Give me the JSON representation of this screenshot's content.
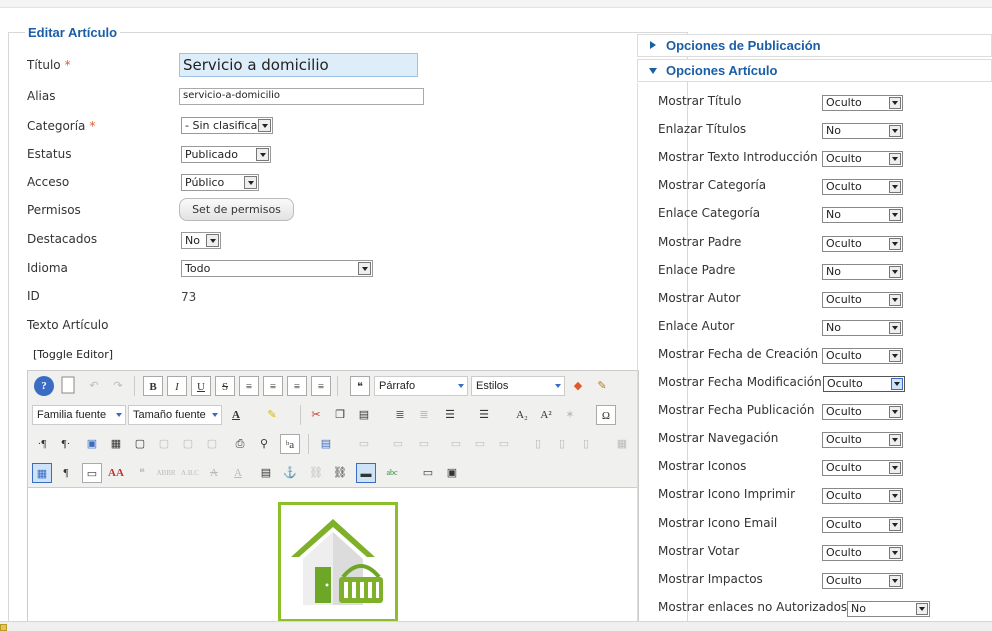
{
  "form": {
    "legend": "Editar Artículo",
    "required_mark": "*",
    "fields": {
      "title_label": "Título",
      "title_value": "Servicio a domicilio",
      "alias_label": "Alias",
      "alias_value": "servicio-a-domicilio",
      "category_label": "Categoría",
      "category_value": "- Sin clasificar",
      "status_label": "Estatus",
      "status_value": "Publicado",
      "access_label": "Acceso",
      "access_value": "Público",
      "permissions_label": "Permisos",
      "permissions_button": "Set de permisos",
      "featured_label": "Destacados",
      "featured_value": "No",
      "language_label": "Idioma",
      "language_value": "Todo",
      "id_label": "ID",
      "id_value": "73",
      "text_label": "Texto Artículo",
      "toggle_editor": "[Toggle Editor]"
    }
  },
  "editor": {
    "format_select": "Párrafo",
    "styles_select": "Estilos",
    "font_family_select": "Familia fuente",
    "font_size_select": "Tamaño fuente",
    "glyphs": {
      "bold": "B",
      "italic": "I",
      "underline": "U",
      "strike": "S",
      "quote": "❝",
      "subscript": "A₂",
      "superscript": "A²",
      "omega": "Ω",
      "pilcrow_ltr": "·¶",
      "pilcrow_rtl": "¶·",
      "pilcrow": "¶",
      "font_a": "A",
      "ba": "ᵇa",
      "abc": "abc"
    },
    "image_alt": "house-with-basket"
  },
  "right_panel": {
    "section_publication": "Opciones de Publicación",
    "section_article": "Opciones Artículo",
    "options": [
      {
        "label": "Mostrar Título",
        "value": "Oculto"
      },
      {
        "label": "Enlazar Títulos",
        "value": "No"
      },
      {
        "label": "Mostrar Texto Introducción",
        "value": "Oculto"
      },
      {
        "label": "Mostrar Categoría",
        "value": "Oculto"
      },
      {
        "label": "Enlace Categoría",
        "value": "No"
      },
      {
        "label": "Mostrar Padre",
        "value": "Oculto"
      },
      {
        "label": "Enlace Padre",
        "value": "No"
      },
      {
        "label": "Mostrar Autor",
        "value": "Oculto"
      },
      {
        "label": "Enlace Autor",
        "value": "No"
      },
      {
        "label": "Mostrar Fecha de Creación",
        "value": "Oculto"
      },
      {
        "label": "Mostrar Fecha Modificación",
        "value": "Oculto"
      },
      {
        "label": "Mostrar Fecha Publicación",
        "value": "Oculto"
      },
      {
        "label": "Mostrar Navegación",
        "value": "Oculto"
      },
      {
        "label": "Mostrar Iconos",
        "value": "Oculto"
      },
      {
        "label": "Mostrar Icono Imprimir",
        "value": "Oculto"
      },
      {
        "label": "Mostrar Icono Email",
        "value": "Oculto"
      },
      {
        "label": "Mostrar Votar",
        "value": "Oculto"
      },
      {
        "label": "Mostrar Impactos",
        "value": "Oculto"
      },
      {
        "label": "Mostrar enlaces no Autorizados",
        "value": "No"
      }
    ]
  },
  "colors": {
    "accent": "#1a5ea6",
    "title_field_bg": "#ddeefa",
    "image_border": "#8dbf2a",
    "required": "#e0592a"
  }
}
